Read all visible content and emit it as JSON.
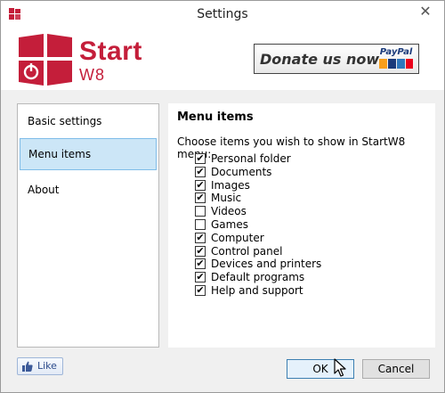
{
  "window": {
    "title": "Settings",
    "close_glyph": "✕"
  },
  "header": {
    "logo_text_main": "Start",
    "logo_text_sub": "W8",
    "donate_label": "Donate us now",
    "paypal_label": "PayPal",
    "brand_color": "#c41e3a"
  },
  "sidebar": {
    "items": [
      {
        "label": "Basic settings",
        "selected": false
      },
      {
        "label": "Menu items",
        "selected": true
      },
      {
        "label": "About",
        "selected": false
      }
    ]
  },
  "content": {
    "title": "Menu items",
    "description": "Choose items you wish to show in StartW8 menu:",
    "items": [
      {
        "label": "Personal folder",
        "checked": true
      },
      {
        "label": "Documents",
        "checked": true
      },
      {
        "label": "Images",
        "checked": true
      },
      {
        "label": "Music",
        "checked": true
      },
      {
        "label": "Videos",
        "checked": false
      },
      {
        "label": "Games",
        "checked": false
      },
      {
        "label": "Computer",
        "checked": true
      },
      {
        "label": "Control panel",
        "checked": true
      },
      {
        "label": "Devices and printers",
        "checked": true
      },
      {
        "label": "Default programs",
        "checked": true
      },
      {
        "label": "Help and support",
        "checked": true
      }
    ]
  },
  "footer": {
    "like_label": "Like",
    "ok_label": "OK",
    "cancel_label": "Cancel"
  },
  "icons": {
    "app": "app-icon",
    "close": "close-icon",
    "like": "thumbs-up-icon",
    "cursor": "mouse-pointer-icon",
    "check": "✔"
  }
}
